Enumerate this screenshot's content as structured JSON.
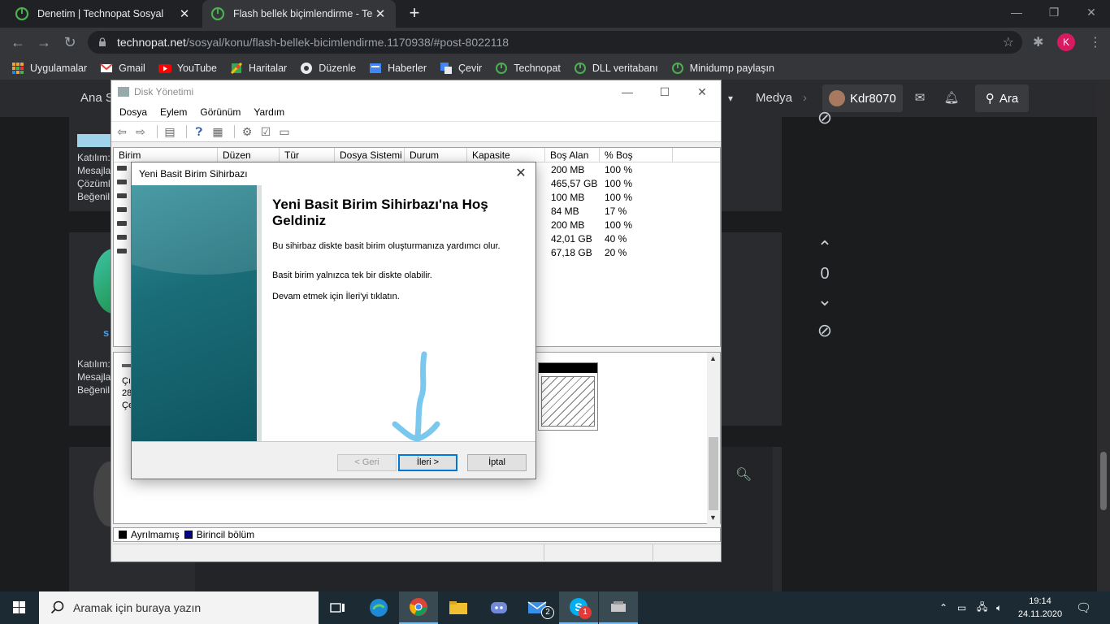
{
  "browser": {
    "tabs": [
      {
        "title": "Denetim | Technopat Sosyal",
        "active": false
      },
      {
        "title": "Flash bellek biçimlendirme - Tech",
        "active": true
      }
    ],
    "url_host": "technopat.net",
    "url_path": "/sosyal/konu/flash-bellek-bicimlendirme.1170938/#post-8022118",
    "profile_letter": "K",
    "bookmarks": [
      "Uygulamalar",
      "Gmail",
      "YouTube",
      "Haritalar",
      "Düzenle",
      "Haberler",
      "Çevir",
      "Technopat",
      "DLL veritabanı",
      "Minidump paylaşın"
    ]
  },
  "site": {
    "nav_left": "Ana S",
    "nav_media": "Medya",
    "username": "Kdr8070",
    "search_label": "Ara",
    "post1_info": [
      "Katılım:",
      "Mesajla",
      "Çözüml",
      "Beğenil"
    ],
    "post2_info": [
      "Katılım:",
      "Mesajla",
      "Beğenil"
    ],
    "vote_count": "0",
    "user_initial": "s"
  },
  "disk_mgmt": {
    "title": "Disk Yönetimi",
    "menu": [
      "Dosya",
      "Eylem",
      "Görünüm",
      "Yardım"
    ],
    "columns": [
      "Birim",
      "Düzen",
      "Tür",
      "Dosya Sistemi",
      "Durum",
      "Kapasite",
      "Boş Alan",
      "% Boş"
    ],
    "rows": [
      {
        "free": "200 MB",
        "pct": "100 %"
      },
      {
        "free": "465,57 GB",
        "pct": "100 %"
      },
      {
        "free": "100 MB",
        "pct": "100 %"
      },
      {
        "free": "84 MB",
        "pct": "17 %"
      },
      {
        "free": "200 MB",
        "pct": "100 %"
      },
      {
        "free": "42,01 GB",
        "pct": "40 %"
      },
      {
        "free": "67,18 GB",
        "pct": "20 %"
      }
    ],
    "graph_left": [
      "Çık",
      "28,",
      "Çe"
    ],
    "legend_unallocated": "Ayrılmamış",
    "legend_primary": "Birincil bölüm",
    "colors": {
      "unallocated": "#000000",
      "primary": "#000080"
    }
  },
  "wizard": {
    "title": "Yeni Basit Birim Sihirbazı",
    "heading": "Yeni Basit Birim Sihirbazı'na Hoş Geldiniz",
    "p1": "Bu sihirbaz diskte basit birim oluşturmanıza yardımcı olur.",
    "p2": "Basit birim yalnızca tek bir diskte olabilir.",
    "p3": "Devam etmek için İleri'yi tıklatın.",
    "back_label": "< Geri",
    "next_label": "İleri >",
    "cancel_label": "İptal"
  },
  "taskbar": {
    "search_placeholder": "Aramak için buraya yazın",
    "mail_badge": "2",
    "skype_badge": "1",
    "time": "19:14",
    "date": "24.11.2020"
  }
}
